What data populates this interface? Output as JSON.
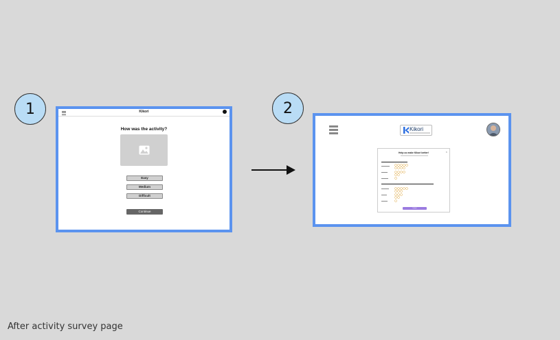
{
  "steps": [
    {
      "number": "1"
    },
    {
      "number": "2"
    }
  ],
  "screen1": {
    "app_title": "Kikori",
    "question": "How was the activity?",
    "options": [
      "Easy",
      "Medium",
      "Difficult"
    ],
    "continue_label": "Continue"
  },
  "screen2": {
    "logo_text": "Kikori",
    "card_title": "Help us make Kikori better!",
    "close_glyph": "×",
    "submit_label": "Submit"
  },
  "caption": "After activity survey page",
  "colors": {
    "background": "#d9d9d9",
    "frame_border": "#5b93ef",
    "step_circle": "#b9dcf5",
    "submit_button": "#9b7be0",
    "star": "#e0a840"
  }
}
